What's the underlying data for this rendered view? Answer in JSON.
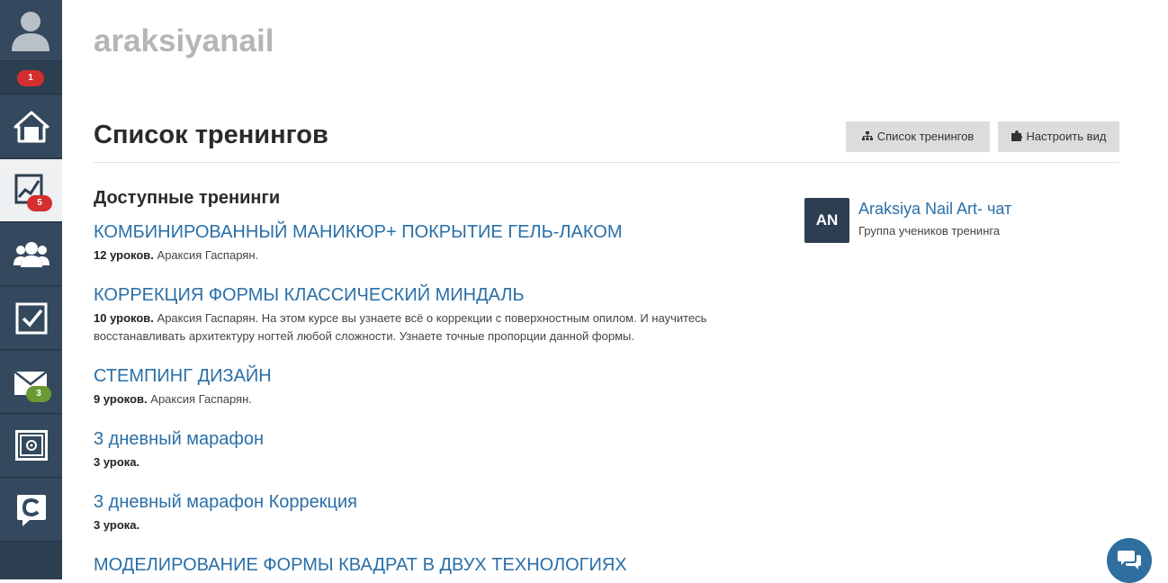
{
  "sidebar": {
    "notifications_badge": "1",
    "trainings_badge": "5",
    "messages_badge": "3",
    "items": [
      {
        "name": "home",
        "icon": "home-icon"
      },
      {
        "name": "trainings",
        "icon": "chart-icon"
      },
      {
        "name": "groups",
        "icon": "users-icon"
      },
      {
        "name": "tasks",
        "icon": "checkbox-icon"
      },
      {
        "name": "messages",
        "icon": "envelope-icon"
      },
      {
        "name": "safe",
        "icon": "safe-icon"
      },
      {
        "name": "getcourse",
        "icon": "getcourse-logo-icon"
      }
    ]
  },
  "header": {
    "school_name": "araksiyanail",
    "page_title": "Список тренингов",
    "btn_list_label": "Список тренингов",
    "btn_view_label": "Настроить вид"
  },
  "main": {
    "section_title": "Доступные тренинги",
    "trainings": [
      {
        "title": "КОМБИНИРОВАННЫЙ МАНИКЮР+ ПОКРЫТИЕ ГЕЛЬ-ЛАКОМ",
        "lessons": "12 уроков.",
        "text": " Араксия Гаспарян."
      },
      {
        "title": "КОРРЕКЦИЯ ФОРМЫ КЛАССИЧЕСКИЙ МИНДАЛЬ",
        "lessons": "10 уроков.",
        "text": " Араксия Гаспарян. На этом курсе вы узнаете всё о коррекции с поверхностным опилом. И научитесь восстанавливать архитектуру ногтей любой сложности. Узнаете точные пропорции данной формы."
      },
      {
        "title": "СТЕМПИНГ ДИЗАЙН",
        "lessons": "9 уроков.",
        "text": " Араксия Гаспарян."
      },
      {
        "title": "3 дневный марафон",
        "lessons": "3 урока.",
        "text": ""
      },
      {
        "title": "3 дневный марафон Коррекция",
        "lessons": "3 урока.",
        "text": ""
      },
      {
        "title": "МОДЕЛИРОВАНИЕ ФОРМЫ КВАДРАТ В ДВУХ ТЕХНОЛОГИЯХ",
        "lessons": "",
        "text": ""
      }
    ]
  },
  "chat": {
    "avatar_initials": "AN",
    "name": "Araksiya Nail Art- чат",
    "subtitle": "Группа учеников тренинга"
  },
  "colors": {
    "sidebar_bg": "#2d3e50",
    "link": "#2a6fa8",
    "badge_red": "#d32f2f",
    "badge_green": "#6a9a32"
  }
}
